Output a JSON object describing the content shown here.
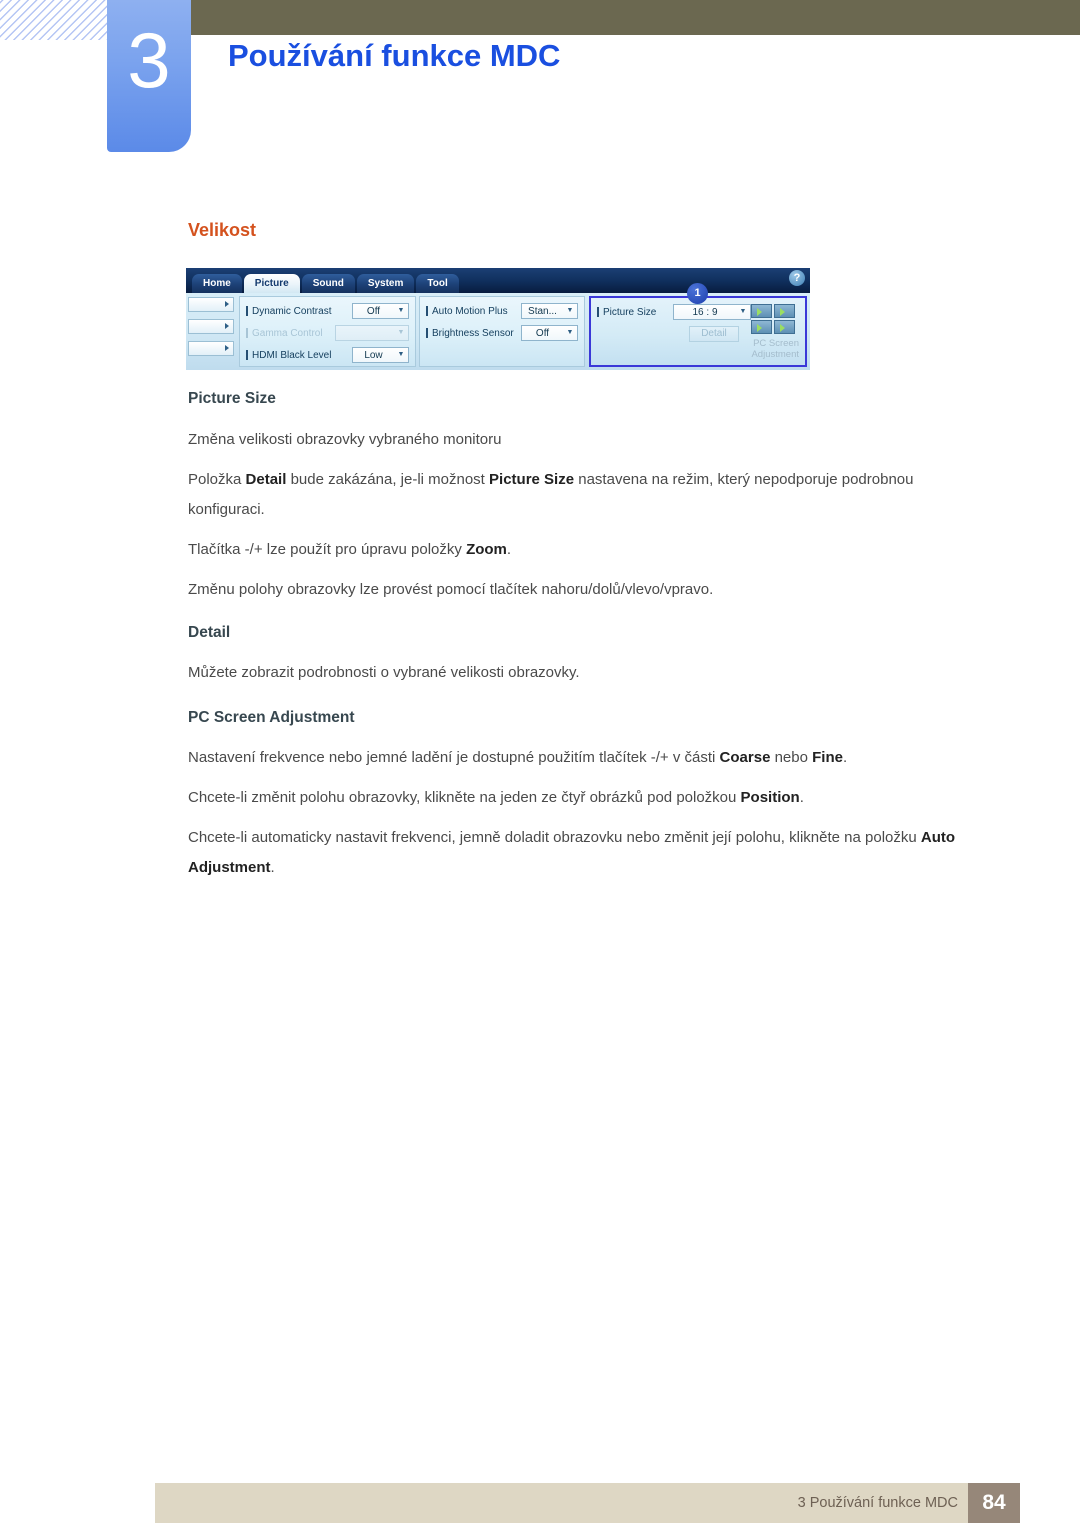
{
  "header": {
    "chapter_number": "3",
    "chapter_title": "Používání funkce MDC"
  },
  "content": {
    "section_heading": "Velikost",
    "blocks": [
      {
        "type": "subhead",
        "text": "Picture Size"
      },
      {
        "type": "para",
        "text": "Změna velikosti obrazovky vybraného monitoru"
      },
      {
        "type": "para",
        "html": "Položka <b>Detail</b> bude zakázána, je-li možnost <b>Picture Size</b> nastavena na režim, který nepodporuje podrobnou konfiguraci."
      },
      {
        "type": "para",
        "html": "Tlačítka -/+ lze použít pro úpravu položky <b>Zoom</b>."
      },
      {
        "type": "para",
        "text": "Změnu polohy obrazovky lze provést pomocí tlačítek nahoru/dolů/vlevo/vpravo."
      },
      {
        "type": "subhead",
        "text": "Detail"
      },
      {
        "type": "para",
        "text": "Můžete zobrazit podrobnosti o vybrané velikosti obrazovky."
      },
      {
        "type": "subhead",
        "text": "PC Screen Adjustment"
      },
      {
        "type": "para",
        "html": "Nastavení frekvence nebo jemné ladění je dostupné použitím tlačítek -/+ v části <b>Coarse</b> nebo <b>Fine</b>."
      },
      {
        "type": "para",
        "html": "Chcete-li změnit polohu obrazovky, klikněte na jeden ze čtyř obrázků pod položkou <b>Position</b>."
      },
      {
        "type": "para",
        "html": "Chcete-li automaticky nastavit frekvenci, jemně doladit obrazovku nebo změnit její polohu, klikněte na položku <b>Auto Adjustment</b>."
      }
    ]
  },
  "mdc_screenshot": {
    "help_icon": "?",
    "callout_badge": "1",
    "tabs": [
      {
        "label": "Home",
        "active": false
      },
      {
        "label": "Picture",
        "active": true
      },
      {
        "label": "Sound",
        "active": false
      },
      {
        "label": "System",
        "active": false
      },
      {
        "label": "Tool",
        "active": false
      }
    ],
    "column1": [
      {
        "label": "Dynamic Contrast",
        "value": "Off",
        "disabled": false
      },
      {
        "label": "Gamma Control",
        "value": "",
        "disabled": true
      },
      {
        "label": "HDMI Black Level",
        "value": "Low",
        "disabled": false
      }
    ],
    "column2": [
      {
        "label": "Auto Motion Plus",
        "value": "Stan...",
        "disabled": false
      },
      {
        "label": "Brightness Sensor",
        "value": "Off",
        "disabled": false
      }
    ],
    "column3": {
      "picture_size_label": "Picture Size",
      "picture_size_value": "16 : 9",
      "detail_button": "Detail",
      "pc_screen_adjustment_label": "PC Screen\nAdjustment"
    }
  },
  "footer": {
    "text": "3 Používání funkce MDC",
    "page_number": "84"
  },
  "colors": {
    "chapter_tab_blue": "#7ba3ee",
    "chapter_title_blue": "#1a4fe0",
    "olive_bar": "#6b6850",
    "section_heading_orange": "#d4521e",
    "subhead_slate": "#37474f",
    "body_gray": "#4a4a4a",
    "footer_bar": "#ded7c4",
    "footer_page_block": "#968779",
    "mdc_highlight_border": "#3a38d8"
  }
}
